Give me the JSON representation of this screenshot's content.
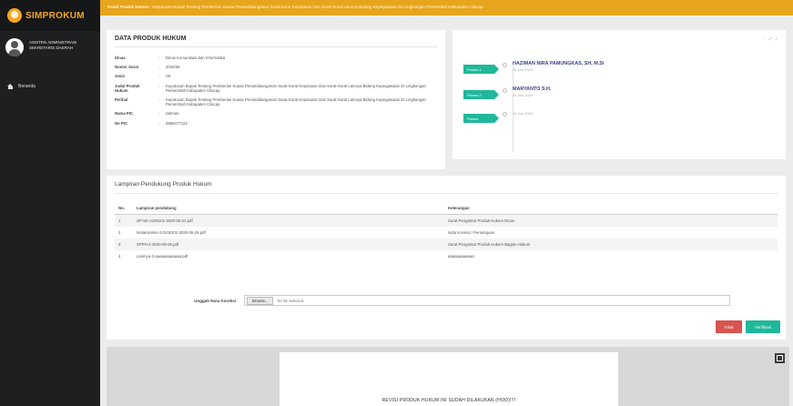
{
  "app": {
    "logo_text": "SIMPROKUM"
  },
  "sidebar": {
    "user_name": "ASISTEN ADMINISTRASI SEKRETARIS DAERAH",
    "items": [
      {
        "label": "Beranda",
        "icon": "home-icon"
      }
    ]
  },
  "topbar": {
    "bold": "Detail Produk Hukum",
    "text": " - Keputusan Bupati Tentang Pemberian Kuasa Penandatanganan Surat-Surat Keputusan Dan Surat-Surat Lainnya Bidang Kepegawaian Di Lingkungan Pemerintah Kabupaten Cilacap"
  },
  "detail": {
    "title": "DATA PRODUK HUKUM",
    "rows": [
      {
        "key": "Dinas",
        "value": "Dinas Komunikasi dan Informatika"
      },
      {
        "key": "Nomor Surat",
        "value": "2020/36"
      },
      {
        "key": "Jenis",
        "value": "SK"
      },
      {
        "key": "Judul Produk Hukum",
        "value": "Keputusan Bupati Tentang Pemberian Kuasa Penandatanganan Surat-Surat Keputusan Dan Surat-Surat Lainnya Bidang Kepegawaian Di Lingkungan Pemerintah Kabupaten Cilacap"
      },
      {
        "key": "Perihal",
        "value": "Keputusan Bupati Tentang Pemberian Kuasa Penandatanganan Surat-Surat Keputusan Dan Surat-Surat Lainnya Bidang Kepegawaian Di Lingkungan Pemerintah Kabupaten Cilacap"
      },
      {
        "key": "Nama PIC",
        "value": "rahman"
      },
      {
        "key": "No PIC",
        "value": "0865477122"
      }
    ]
  },
  "timeline": {
    "tools": "– ⤢ ×",
    "items": [
      {
        "badge": "Proses 1",
        "name": "HAZIMAN NIRA PAMUNGKAS, SH, M.Si",
        "date": "28 Juni 2020"
      },
      {
        "badge": "Proses 2",
        "name": "MARYANTO S.H.",
        "date": "28 Juni 2020"
      },
      {
        "badge": "Proses",
        "name": "",
        "date": "28 Juni 2020"
      }
    ]
  },
  "lampiran": {
    "title": "Lampiran Pendukung Produk Hukum",
    "headers": [
      "No.",
      "Lampiran pendukung",
      "Keterangan"
    ],
    "rows": [
      {
        "no": "1",
        "file": "SP-SK-2100101-2020-06-22.pdf",
        "ket": "Surat Pengantar Produk Hukum Dinas"
      },
      {
        "no": "2",
        "file": "NotaKoreksi-2.0100101-2020-06-26.pdf",
        "ket": "Nota Koreksi / Persetujuan"
      },
      {
        "no": "3",
        "file": "SPPH-2-2020-06-26.pdf",
        "ket": "Surat Pengantar Produk Hukum Bagian Hukum"
      },
      {
        "no": "4",
        "file": "Lainnya-2-aaaaaaaaaaaa.pdf",
        "ket": "aaaaaaaaaaaa"
      }
    ],
    "upload_label": "Unggah Nota Koreksi",
    "browse_label": "Browse...",
    "no_file": "No file selected."
  },
  "actions": {
    "tolak": "Tolak",
    "verifikasi": "Verifikasi"
  },
  "preview": {
    "text": "REVISI PRODUK HUKUM INI SUDAH DILAKUKAN (HOO)!!!!"
  }
}
